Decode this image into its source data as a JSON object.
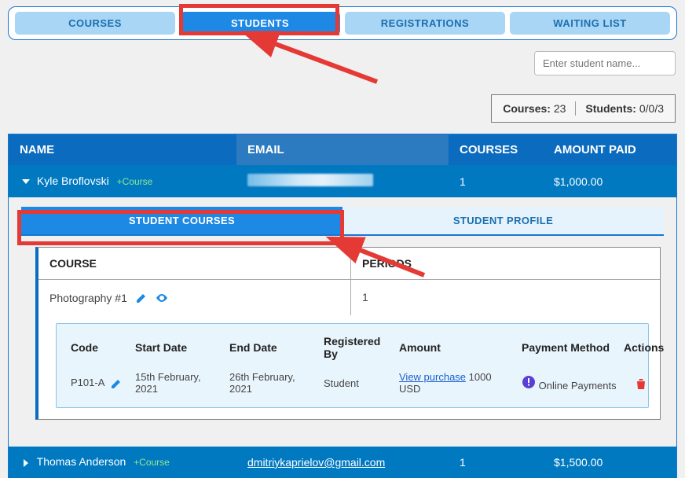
{
  "nav": {
    "tabs": [
      "COURSES",
      "STUDENTS",
      "REGISTRATIONS",
      "WAITING LIST"
    ],
    "active_index": 1
  },
  "search": {
    "placeholder": "Enter student name..."
  },
  "summary": {
    "courses_label": "Courses:",
    "courses_value": "23",
    "students_label": "Students:",
    "students_value": "0/0/3"
  },
  "table": {
    "headers": {
      "name": "NAME",
      "email": "EMAIL",
      "courses": "COURSES",
      "amount": "AMOUNT PAID"
    },
    "rows": [
      {
        "expanded": true,
        "name": "Kyle Broflovski",
        "add_label": "+Course",
        "email_redacted": true,
        "email": "",
        "courses": "1",
        "amount": "$1,000.00"
      },
      {
        "expanded": false,
        "name": "Thomas Anderson",
        "add_label": "+Course",
        "email_redacted": false,
        "email": "dmitriykaprielov@gmail.com",
        "courses": "1",
        "amount": "$1,500.00"
      }
    ]
  },
  "subtabs": {
    "courses": "STUDENT COURSES",
    "profile": "STUDENT PROFILE"
  },
  "detail": {
    "headers": {
      "course": "COURSE",
      "periods": "PERIODS"
    },
    "course_name": "Photography #1",
    "periods": "1",
    "inner_headers": {
      "code": "Code",
      "start": "Start Date",
      "end": "End Date",
      "reg": "Registered By",
      "amount": "Amount",
      "pay": "Payment Method",
      "actions": "Actions"
    },
    "inner_row": {
      "code": "P101-A",
      "start": "15th February, 2021",
      "end": "26th February, 2021",
      "reg": "Student",
      "purchase_link": "View purchase",
      "amount_text": "1000 USD",
      "pay": "Online Payments"
    }
  }
}
